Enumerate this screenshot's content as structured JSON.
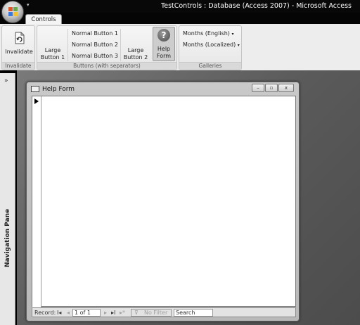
{
  "window": {
    "title": "TestControls : Database (Access 2007) - Microsoft Access",
    "qat_symbol": "▾"
  },
  "ribbon": {
    "tabs": [
      {
        "label": "Controls"
      }
    ],
    "groups": {
      "invalidate": {
        "label": "Invalidate",
        "button_label": "Invalidate"
      },
      "buttons": {
        "label": "Buttons (with separators)",
        "large_button_1": "Large\nButton 1",
        "normal_button_1": "Normal Button 1",
        "normal_button_2": "Normal Button 2",
        "normal_button_3": "Normal Button 3",
        "large_button_2": "Large\nButton 2",
        "help_form": "Help\nForm"
      },
      "galleries": {
        "label": "Galleries",
        "months_english": "Months (English)",
        "months_localized": "Months (Localized)",
        "dropdown_symbol": "▾"
      }
    }
  },
  "nav_pane": {
    "label": "Navigation Pane",
    "toggle_symbol": "»"
  },
  "form": {
    "title": "Help Form",
    "minimize_symbol": "–",
    "restore_symbol": "▫",
    "close_symbol": "x",
    "record_nav": {
      "record_label": "Record:",
      "first_symbol": "I◂",
      "prev_symbol": "◂",
      "position": "1 of 1",
      "next_symbol": "▸",
      "last_symbol": "▸I",
      "new_symbol": "▸*",
      "filter_label": "No Filter",
      "search_label": "Search"
    }
  },
  "colors": {
    "title_bar": "#080808",
    "ribbon_bg": "#ededed",
    "workspace": "#5a5a5a"
  }
}
